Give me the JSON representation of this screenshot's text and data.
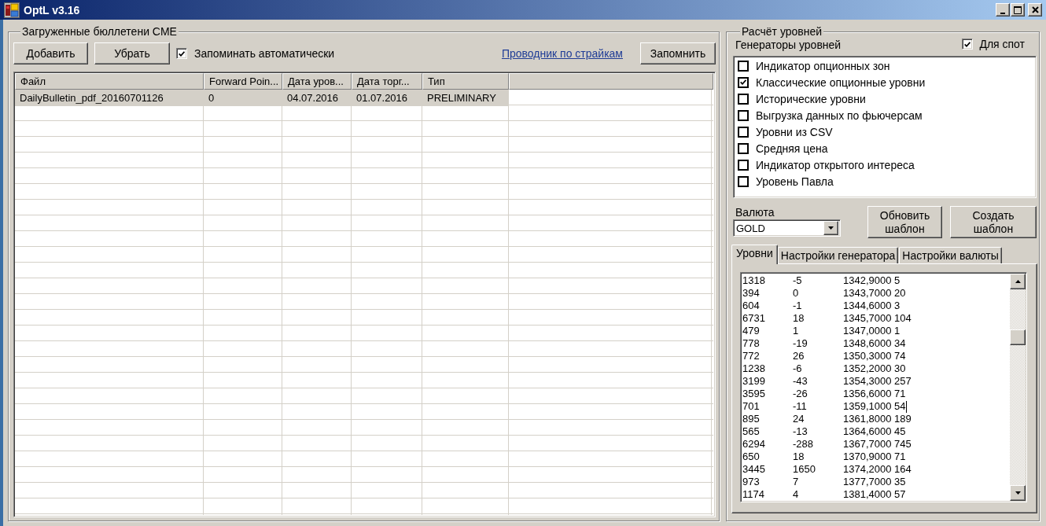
{
  "window": {
    "title": "OptL v3.16"
  },
  "bulletins": {
    "title": "Загруженные бюллетени CME",
    "buttons": [
      "Добавить",
      "Убрать"
    ],
    "auto_save": {
      "label": "Запоминать автоматически",
      "checked": true
    },
    "link": "Проводник по страйкам",
    "save_button": "Запомнить",
    "table": {
      "columns": [
        "Файл",
        "Forward Poin...",
        "Дата уров...",
        "Дата торг...",
        "Тип"
      ],
      "rows": [
        {
          "cells": [
            "DailyBulletin_pdf_20160701126",
            "0",
            "04.07.2016",
            "01.07.2016",
            "PRELIMINARY"
          ],
          "selected": true
        }
      ]
    }
  },
  "levels": {
    "title": "Расчёт уровней",
    "generators_label": "Генераторы уровней",
    "spot": {
      "label": "Для спот",
      "checked": true
    },
    "generators": [
      {
        "label": "Индикатор опционных зон",
        "checked": false
      },
      {
        "label": "Классические опционные уровни",
        "checked": true
      },
      {
        "label": "Исторические уровни",
        "checked": false
      },
      {
        "label": "Выгрузка данных по фьючерсам",
        "checked": false
      },
      {
        "label": "Уровни из CSV",
        "checked": false
      },
      {
        "label": "Средняя цена",
        "checked": false
      },
      {
        "label": "Индикатор открытого интереса",
        "checked": false
      },
      {
        "label": "Уровень Павла",
        "checked": false
      }
    ],
    "currency": {
      "label": "Валюта",
      "value": "GOLD"
    },
    "buttons": [
      "Обновить шаблон",
      "Создать шаблон"
    ],
    "tabs": [
      {
        "label": "Уровни",
        "selected": true
      },
      {
        "label": "Настройки генератора",
        "selected": false
      },
      {
        "label": "Настройки валюты",
        "selected": false
      }
    ],
    "output_lines": [
      {
        "text": "1318\t-5\t1342,9000 5",
        "cursor": false
      },
      {
        "text": "394\t0\t1343,7000 20",
        "cursor": false
      },
      {
        "text": "604\t-1\t1344,6000 3",
        "cursor": false
      },
      {
        "text": "6731\t18\t1345,7000 104",
        "cursor": false
      },
      {
        "text": "479\t1\t1347,0000 1",
        "cursor": false
      },
      {
        "text": "778\t-19\t1348,6000 34",
        "cursor": false
      },
      {
        "text": "772\t26\t1350,3000 74",
        "cursor": false
      },
      {
        "text": "1238\t-6\t1352,2000 30",
        "cursor": false
      },
      {
        "text": "3199\t-43\t1354,3000 257",
        "cursor": false
      },
      {
        "text": "3595\t-26\t1356,6000 71",
        "cursor": false
      },
      {
        "text": "701\t-11\t1359,1000 54",
        "cursor": true
      },
      {
        "text": "895\t24\t1361,8000 189",
        "cursor": false
      },
      {
        "text": "565\t-13\t1364,6000 45",
        "cursor": false
      },
      {
        "text": "6294\t-288\t1367,7000 745",
        "cursor": false
      },
      {
        "text": "650\t18\t1370,9000 71",
        "cursor": false
      },
      {
        "text": "3445\t1650\t1374,2000 164",
        "cursor": false
      },
      {
        "text": "973\t7\t1377,7000 35",
        "cursor": false
      },
      {
        "text": "1174\t4\t1381,4000 57",
        "cursor": false
      }
    ]
  }
}
